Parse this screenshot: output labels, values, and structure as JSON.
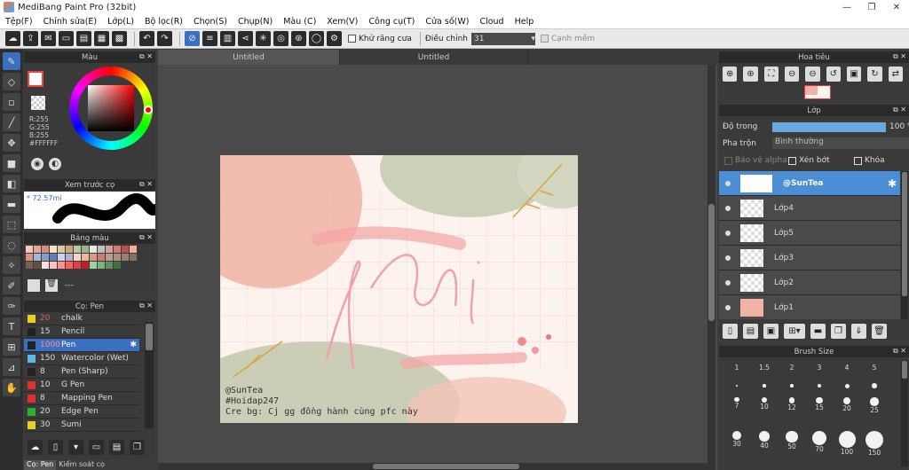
{
  "window": {
    "title": "MediBang Paint Pro (32bit)",
    "controls": [
      "—",
      "❐",
      "✕"
    ]
  },
  "menu": [
    "Tệp(F)",
    "Chỉnh sửa(E)",
    "Lớp(L)",
    "Bộ lọc(R)",
    "Chọn(S)",
    "Chụp(N)",
    "Màu (C)",
    "Xem(V)",
    "Công cụ(T)",
    "Cửa số(W)",
    "Cloud",
    "Help"
  ],
  "toolbar": {
    "antialias_label": "Khử răng cưa",
    "adjust_label": "Điều chỉnh",
    "adjust_value": "31",
    "smooth_edge_label": "Cạnh mềm"
  },
  "color_panel": {
    "title": "Màu",
    "r": "R:255",
    "g": "G:255",
    "b": "B:255",
    "hex": "#FFFFFF"
  },
  "brush_preview": {
    "title": "Xem trước cọ",
    "size": "* 72.57mi"
  },
  "palette": {
    "title": "Bảng màu",
    "name": "---",
    "swatches": [
      "#f3c7c2",
      "#e8a39a",
      "#d98b80",
      "#f5e3c8",
      "#e0c9a0",
      "#c9a87a",
      "#b8c9a8",
      "#9fb38a",
      "#e8e8e8",
      "#c0c0c0",
      "#d4a0a0",
      "#c97a7a",
      "#b85050",
      "#f0b0a0",
      "#e09080",
      "#a0b8d8",
      "#80a0c8",
      "#6080b0",
      "#d0d0e8",
      "#b0b0d0",
      "#f4d4c4",
      "#e8b8a0",
      "#d89c88",
      "#c88070",
      "#b8a090",
      "#a89080",
      "#988070",
      "#887060",
      "#786050",
      "#605040",
      "#ffe0e0",
      "#ffc0c0",
      "#ff9090",
      "#ff6060",
      "#e04040",
      "#c02020",
      "#a0d0a0",
      "#80b080",
      "#609060",
      "#407040"
    ]
  },
  "brush_panel": {
    "title": "Cọ: Pen",
    "items": [
      {
        "size": "20",
        "name": "chalk",
        "color": "#e8d020"
      },
      {
        "size": "15",
        "name": "Pencil",
        "color": "#222222"
      },
      {
        "size": "1000",
        "name": "Pen",
        "color": "#222222"
      },
      {
        "size": "150",
        "name": "Watercolor (Wet)",
        "color": "#5ab8e8"
      },
      {
        "size": "8",
        "name": "Pen (Sharp)",
        "color": "#222222"
      },
      {
        "size": "10",
        "name": "G Pen",
        "color": "#e03030"
      },
      {
        "size": "8",
        "name": "Mapping Pen",
        "color": "#e03030"
      },
      {
        "size": "20",
        "name": "Edge Pen",
        "color": "#30b030"
      },
      {
        "size": "30",
        "name": "Sumi",
        "color": "#e8d020"
      }
    ]
  },
  "bottom_tabs": [
    "Cọ: Pen",
    "Kiểm soát cọ"
  ],
  "canvas_tabs": [
    "Untitled",
    "Untitled"
  ],
  "artwork": {
    "title_text": "thi",
    "credit_lines": [
      "@SunTea",
      "#Hoidap247",
      "Cre bg: Cj gg đồng hành cùng pfc này"
    ]
  },
  "navigator": {
    "title": "Hoa tiêu"
  },
  "layer_panel": {
    "title": "Lớp",
    "opacity_label": "Độ trong",
    "opacity_value": "100 %",
    "opacity_fraction": 1.0,
    "blend_label": "Pha trộn",
    "blend_value": "Bình thường",
    "protect_alpha": "Bảo vệ alpha",
    "clipping": "Xén bớt",
    "lock": "Khóa",
    "layers": [
      "@SunTea",
      "Lớp4",
      "Lớp5",
      "Lớp3",
      "Lớp2",
      "Lớp1"
    ]
  },
  "brush_size_panel": {
    "title": "Brush Size",
    "row1": [
      "1",
      "1.5",
      "2",
      "3",
      "4",
      "5"
    ],
    "row2": [
      "7",
      "10",
      "12",
      "15",
      "20",
      "25"
    ],
    "row3": [
      "30",
      "40",
      "50",
      "70",
      "100",
      "150"
    ]
  },
  "colors": {
    "accent": "#3b6fc0",
    "selected_layer": "#4a8fd6",
    "panel": "#3a3a3a"
  }
}
